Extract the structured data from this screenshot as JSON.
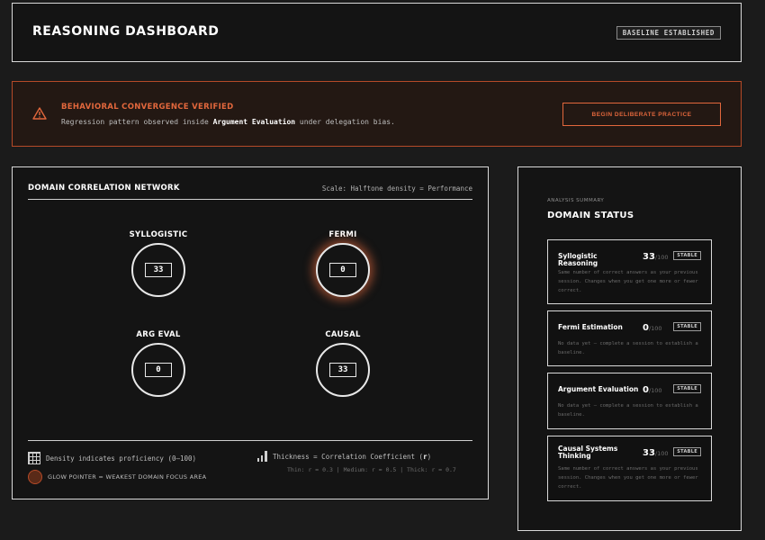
{
  "header": {
    "title": "REASONING DASHBOARD",
    "badge": "BASELINE ESTABLISHED"
  },
  "alert": {
    "title": "BEHAVIORAL CONVERGENCE VERIFIED",
    "body_pre": "Regression pattern observed inside ",
    "body_emph": "Argument Evaluation",
    "body_post": " under delegation bias.",
    "button_label": "BEGIN DELIBERATE PRACTICE",
    "accent": "#e2673c"
  },
  "network": {
    "title": "DOMAIN CORRELATION NETWORK",
    "scale_note": "Scale: Halftone density = Performance",
    "nodes": [
      {
        "label": "SYLLOGISTIC",
        "score": "33"
      },
      {
        "label": "FERMI",
        "score": "0"
      },
      {
        "label": "ARG EVAL",
        "score": "0"
      },
      {
        "label": "CAUSAL",
        "score": "33"
      }
    ],
    "legend": {
      "density": "Density indicates proficiency (0–100)",
      "glow": "GLOW POINTER = WEAKEST DOMAIN FOCUS AREA",
      "thickness_pre": "Thickness = Correlation Coefficient (",
      "thickness_sym": "r",
      "thickness_post": ")",
      "thickness_sub": "Thin: r ≈ 0.3 | Medium: r ≈ 0.5 | Thick: r ≈ 0.7"
    }
  },
  "status": {
    "eyebrow": "ANALYSIS SUMMARY",
    "title": "DOMAIN STATUS",
    "outof": "/100",
    "cards": [
      {
        "name": "Syllogistic Reasoning",
        "score": "33",
        "badge": "STABLE",
        "desc": "Same number of correct answers as your previous session. Changes when you get one more or fewer correct."
      },
      {
        "name": "Fermi Estimation",
        "score": "0",
        "badge": "STABLE",
        "desc": "No data yet — complete a session to establish a baseline."
      },
      {
        "name": "Argument Evaluation",
        "score": "0",
        "badge": "STABLE",
        "desc": "No data yet — complete a session to establish a baseline."
      },
      {
        "name": "Causal Systems Thinking",
        "score": "33",
        "badge": "STABLE",
        "desc": "Same number of correct answers as your previous session. Changes when you get one more or fewer correct."
      }
    ]
  }
}
